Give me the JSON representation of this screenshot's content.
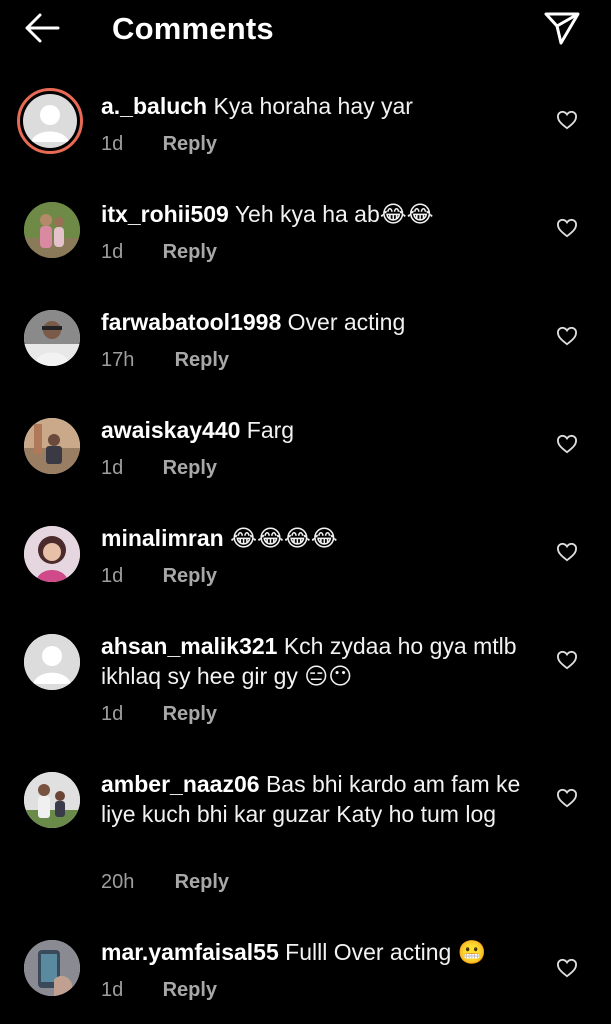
{
  "header": {
    "title": "Comments",
    "back_icon": "arrow-left-icon",
    "send_icon": "paper-plane-icon"
  },
  "comments": [
    {
      "username": "a._baluch",
      "text": "Kya horaha hay yar",
      "time": "1d",
      "reply": "Reply",
      "avatar": "default"
    },
    {
      "username": "itx_rohii509",
      "text": "Yeh kya ha ab😂😂",
      "time": "1d",
      "reply": "Reply",
      "avatar": "photo"
    },
    {
      "username": "farwabatool1998",
      "text": "Over acting",
      "time": "17h",
      "reply": "Reply",
      "avatar": "photo"
    },
    {
      "username": "awaiskay440",
      "text": "Farg",
      "time": "1d",
      "reply": "Reply",
      "avatar": "photo"
    },
    {
      "username": "minalimran",
      "text": "😂😂😂😂",
      "time": "1d",
      "reply": "Reply",
      "avatar": "photo"
    },
    {
      "username": "ahsan_malik321",
      "text": "Kch zydaa ho gya mtlb ikhlaq sy hee gir gy 😑😶",
      "time": "1d",
      "reply": "Reply",
      "avatar": "default"
    },
    {
      "username": "amber_naaz06",
      "text": "Bas bhi kardo am fam ke liye kuch bhi kar guzar Katy ho tum log",
      "time": "20h",
      "reply": "Reply",
      "avatar": "photo"
    },
    {
      "username": "mar.yamfaisal55",
      "text": "Fulll Over acting 😬",
      "time": "1d",
      "reply": "Reply",
      "avatar": "photo"
    }
  ],
  "colors": {
    "background": "#000000",
    "text": "#ffffff",
    "muted": "#9e9e9e",
    "story_ring": "#e86a54"
  }
}
